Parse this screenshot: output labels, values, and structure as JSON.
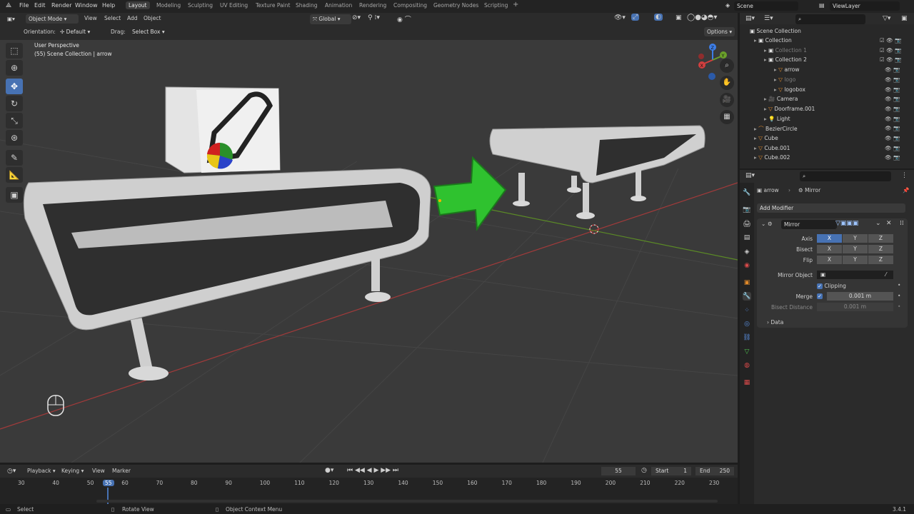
{
  "topbar": {
    "menus": [
      "File",
      "Edit",
      "Render",
      "Window",
      "Help"
    ],
    "workspaces": [
      "Layout",
      "Modeling",
      "Sculpting",
      "UV Editing",
      "Texture Paint",
      "Shading",
      "Animation",
      "Rendering",
      "Compositing",
      "Geometry Nodes",
      "Scripting"
    ],
    "active_workspace": "Layout",
    "scene": "Scene",
    "view_layer": "ViewLayer"
  },
  "viewport_header": {
    "mode": "Object Mode",
    "menus": [
      "View",
      "Select",
      "Add",
      "Object"
    ],
    "transform": "Global",
    "orientation_label": "Orientation:",
    "orientation_value": "Default",
    "drag_label": "Drag:",
    "drag_value": "Select Box",
    "options": "Options"
  },
  "viewport": {
    "perspective": "User Perspective",
    "collection_info": "(55) Scene Collection | arrow",
    "gizmo_axes": [
      "Z",
      "Y",
      "X"
    ]
  },
  "outliner": {
    "root": "Scene Collection",
    "rows": [
      {
        "label": "Collection",
        "indent": 1,
        "type": "collection",
        "dim": false
      },
      {
        "label": "Collection 1",
        "indent": 2,
        "type": "collection",
        "dim": true
      },
      {
        "label": "Collection 2",
        "indent": 2,
        "type": "collection",
        "dim": false
      },
      {
        "label": "arrow",
        "indent": 3,
        "type": "mesh",
        "dim": false
      },
      {
        "label": "logo",
        "indent": 3,
        "type": "mesh",
        "dim": true
      },
      {
        "label": "logobox",
        "indent": 3,
        "type": "mesh",
        "dim": false
      },
      {
        "label": "Camera",
        "indent": 2,
        "type": "camera",
        "dim": false
      },
      {
        "label": "Doorframe.001",
        "indent": 2,
        "type": "mesh",
        "dim": false
      },
      {
        "label": "Light",
        "indent": 2,
        "type": "light",
        "dim": false
      },
      {
        "label": "BezierCircle",
        "indent": 1,
        "type": "curve",
        "dim": false
      },
      {
        "label": "Cube",
        "indent": 1,
        "type": "mesh",
        "dim": false
      },
      {
        "label": "Cube.001",
        "indent": 1,
        "type": "mesh",
        "dim": false
      },
      {
        "label": "Cube.002",
        "indent": 1,
        "type": "mesh",
        "dim": false
      }
    ]
  },
  "properties": {
    "object": "arrow",
    "modifier_tab": "Mirror",
    "add_modifier": "Add Modifier",
    "modifier_name": "Mirror",
    "axis_label": "Axis",
    "bisect_label": "Bisect",
    "flip_label": "Flip",
    "xyz": [
      "X",
      "Y",
      "Z"
    ],
    "mirror_object_label": "Mirror Object",
    "clipping_label": "Clipping",
    "merge_label": "Merge",
    "merge_value": "0.001 m",
    "bisect_distance_label": "Bisect Distance",
    "bisect_distance_value": "0.001 m",
    "data_label": "Data"
  },
  "timeline": {
    "menus": [
      "Playback",
      "Keying",
      "View",
      "Marker"
    ],
    "current_frame": "55",
    "start_label": "Start",
    "start_value": "1",
    "end_label": "End",
    "end_value": "250",
    "ticks": [
      "30",
      "40",
      "50",
      "55",
      "60",
      "70",
      "80",
      "90",
      "100",
      "110",
      "120",
      "130",
      "140",
      "150",
      "160",
      "170",
      "180",
      "190",
      "200",
      "210",
      "220",
      "230"
    ]
  },
  "statusbar": {
    "select": "Select",
    "rotate": "Rotate View",
    "context": "Object Context Menu",
    "version": "3.4.1"
  },
  "colors": {
    "accent": "#4772b3",
    "arrow_green": "#2fc22f",
    "x_axis": "#b83a3a",
    "y_axis": "#6b9e2a"
  }
}
